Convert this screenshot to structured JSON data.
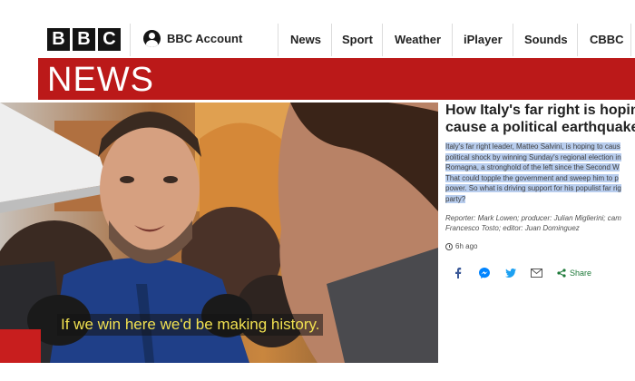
{
  "header": {
    "logo_letters": [
      "B",
      "B",
      "C"
    ],
    "account_label": "BBC Account",
    "nav_items": [
      "News",
      "Sport",
      "Weather",
      "iPlayer",
      "Sounds",
      "CBBC"
    ]
  },
  "banner": {
    "title": "NEWS",
    "color": "#bb1919"
  },
  "video": {
    "subtitle": "If we win here we'd be making history."
  },
  "article": {
    "headline_line1": "How Italy's far right is hoping",
    "headline_line2": "cause a political earthquake",
    "summary_lines": [
      "Italy's far right leader, Matteo Salvini, is hoping to caus",
      "political shock by winning Sunday's regional election in",
      "Romagna, a stronghold of the left since the Second W",
      "That could topple the government and sweep him to p",
      "power. So what is driving support for his populist far rig",
      "party?"
    ],
    "credits_line1": "Reporter: Mark Lowen; producer: Julian Miglierini; cam",
    "credits_line2": "Francesco Tosto; editor: Juan Dominguez",
    "timestamp": "6h ago"
  },
  "share": {
    "icons": [
      "facebook-icon",
      "messenger-icon",
      "twitter-icon",
      "email-icon"
    ],
    "label": "Share",
    "colors": {
      "facebook": "#3b5998",
      "messenger": "#0084ff",
      "twitter": "#1da1f2",
      "email": "#555555",
      "share": "#1f7a3a"
    }
  }
}
